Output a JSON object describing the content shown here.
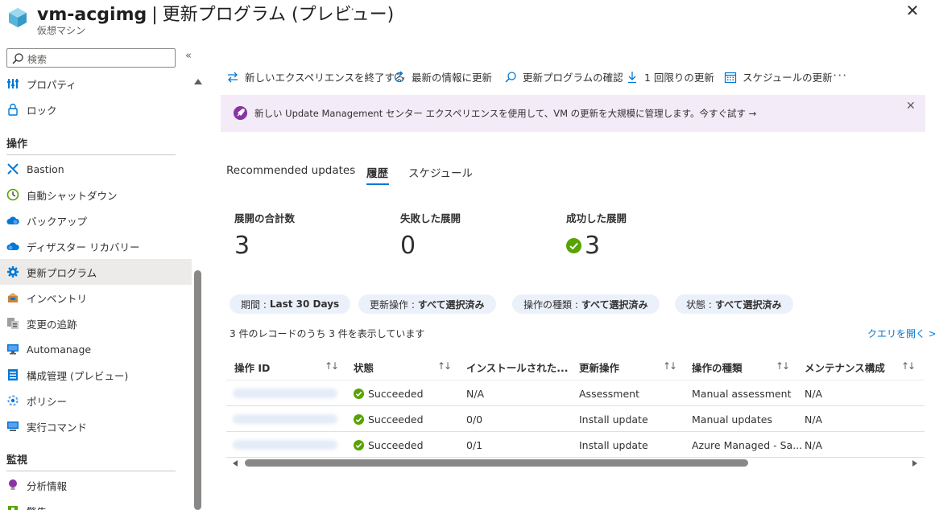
{
  "header": {
    "resource_name": "vm-acgimg",
    "separator": "|",
    "page_name": "更新プログラム (プレビュー)",
    "more": "···",
    "resource_type": "仮想マシン",
    "close": "✕"
  },
  "sidebar": {
    "search_placeholder": "検索",
    "collapse": "«",
    "items_top": [
      {
        "label": "プロパティ",
        "icon": "properties-icon"
      },
      {
        "label": "ロック",
        "icon": "lock-icon"
      }
    ],
    "section_operations": "操作",
    "items_operations": [
      {
        "label": "Bastion",
        "icon": "bastion-icon"
      },
      {
        "label": "自動シャットダウン",
        "icon": "clock-icon"
      },
      {
        "label": "バックアップ",
        "icon": "backup-cloud-icon"
      },
      {
        "label": "ディザスター リカバリー",
        "icon": "disaster-recovery-cloud-icon"
      },
      {
        "label": "更新プログラム",
        "icon": "gear-icon",
        "selected": true
      },
      {
        "label": "インベントリ",
        "icon": "inventory-box-icon"
      },
      {
        "label": "変更の追跡",
        "icon": "change-tracking-icon"
      },
      {
        "label": "Automanage",
        "icon": "automanage-monitor-icon"
      },
      {
        "label": "構成管理 (プレビュー)",
        "icon": "config-list-icon"
      },
      {
        "label": "ポリシー",
        "icon": "policy-gear-icon"
      },
      {
        "label": "実行コマンド",
        "icon": "run-command-icon"
      }
    ],
    "section_monitoring": "監視",
    "items_monitoring": [
      {
        "label": "分析情報",
        "icon": "insights-bulb-icon"
      },
      {
        "label": "警告",
        "icon": "alerts-icon"
      }
    ]
  },
  "toolbar": {
    "exit_experience": "新しいエクスペリエンスを終了する",
    "refresh": "最新の情報に更新",
    "check_updates": "更新プログラムの確認",
    "one_time_update": "1 回限りの更新",
    "schedule_update": "スケジュールの更新",
    "more": "···"
  },
  "banner": {
    "message": "新しい Update Management センター エクスペリエンスを使用して、VM の更新を大規模に管理します。今すぐ試す →",
    "close": "✕"
  },
  "tabs": [
    {
      "label": "Recommended updates",
      "active": false
    },
    {
      "label": "履歴",
      "active": true
    },
    {
      "label": "スケジュール",
      "active": false
    }
  ],
  "stats": {
    "total_label": "展開の合計数",
    "total_value": "3",
    "failed_label": "失敗した展開",
    "failed_value": "0",
    "succeeded_label": "成功した展開",
    "succeeded_value": "3"
  },
  "filters": [
    {
      "key": "期間 :",
      "value": "Last 30 Days"
    },
    {
      "key": "更新操作 :",
      "value": "すべて選択済み"
    },
    {
      "key": "操作の種類 :",
      "value": "すべて選択済み"
    },
    {
      "key": "状態 :",
      "value": "すべて選択済み"
    }
  ],
  "records_text": "3 件のレコードのうち 3 件を表示しています",
  "query_link": "クエリを開く >",
  "table": {
    "columns": [
      "操作 ID",
      "状態",
      "インストールされた...",
      "更新操作",
      "操作の種類",
      "メンテナンス構成"
    ],
    "sort_glyph": "↑↓",
    "rows": [
      {
        "status": "Succeeded",
        "installed": "N/A",
        "operation": "Assessment",
        "type": "Manual assessment",
        "maintenance": "N/A"
      },
      {
        "status": "Succeeded",
        "installed": "0/0",
        "operation": "Install update",
        "type": "Manual updates",
        "maintenance": "N/A"
      },
      {
        "status": "Succeeded",
        "installed": "0/1",
        "operation": "Install update",
        "type": "Azure Managed - Sa...",
        "maintenance": "N/A"
      }
    ]
  },
  "colors": {
    "accent": "#0078d4",
    "success": "#57a300",
    "banner_bg": "#f3ebf7",
    "pill_bg": "#eaf1fb",
    "selected_bg": "#edebe9"
  }
}
